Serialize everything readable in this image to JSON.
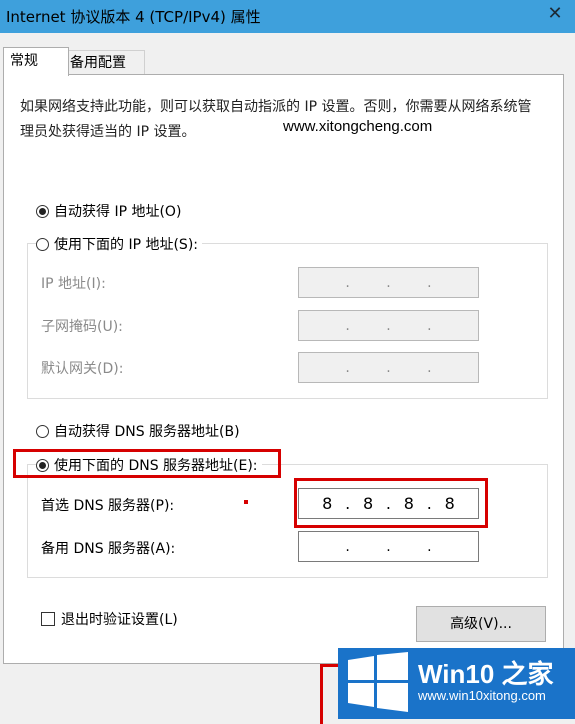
{
  "window": {
    "title": "Internet 协议版本 4 (TCP/IPv4) 属性",
    "close": "✕"
  },
  "tabs": [
    {
      "label": "常规"
    },
    {
      "label": "备用配置"
    }
  ],
  "description": "如果网络支持此功能，则可以获取自动指派的 IP 设置。否则，你需要从网络系统管理员处获得适当的 IP 设置。",
  "watermark": "www.xitongcheng.com",
  "ip": {
    "auto_label": "自动获得 IP 地址(O)",
    "manual_label": "使用下面的 IP 地址(S):",
    "auto_selected": true,
    "fields": [
      {
        "label": "IP 地址(I):",
        "octets": [
          "",
          "",
          "",
          ""
        ]
      },
      {
        "label": "子网掩码(U):",
        "octets": [
          "",
          "",
          "",
          ""
        ]
      },
      {
        "label": "默认网关(D):",
        "octets": [
          "",
          "",
          "",
          ""
        ]
      }
    ]
  },
  "dns": {
    "auto_label": "自动获得 DNS 服务器地址(B)",
    "manual_label": "使用下面的 DNS 服务器地址(E):",
    "manual_selected": true,
    "preferred": {
      "label": "首选 DNS 服务器(P):",
      "octets": [
        "8",
        "8",
        "8",
        "8"
      ]
    },
    "alternate": {
      "label": "备用 DNS 服务器(A):",
      "octets": [
        "",
        "",
        "",
        ""
      ]
    }
  },
  "validate_label": "退出时验证设置(L)",
  "advanced_button": "高级(V)...",
  "logo": {
    "brand": "Win10 之家",
    "url": "www.win10xitong.com"
  },
  "colors": {
    "titlebar": "#3ea0dc",
    "highlight": "#d60000",
    "logo_bg": "#1a73c9"
  }
}
